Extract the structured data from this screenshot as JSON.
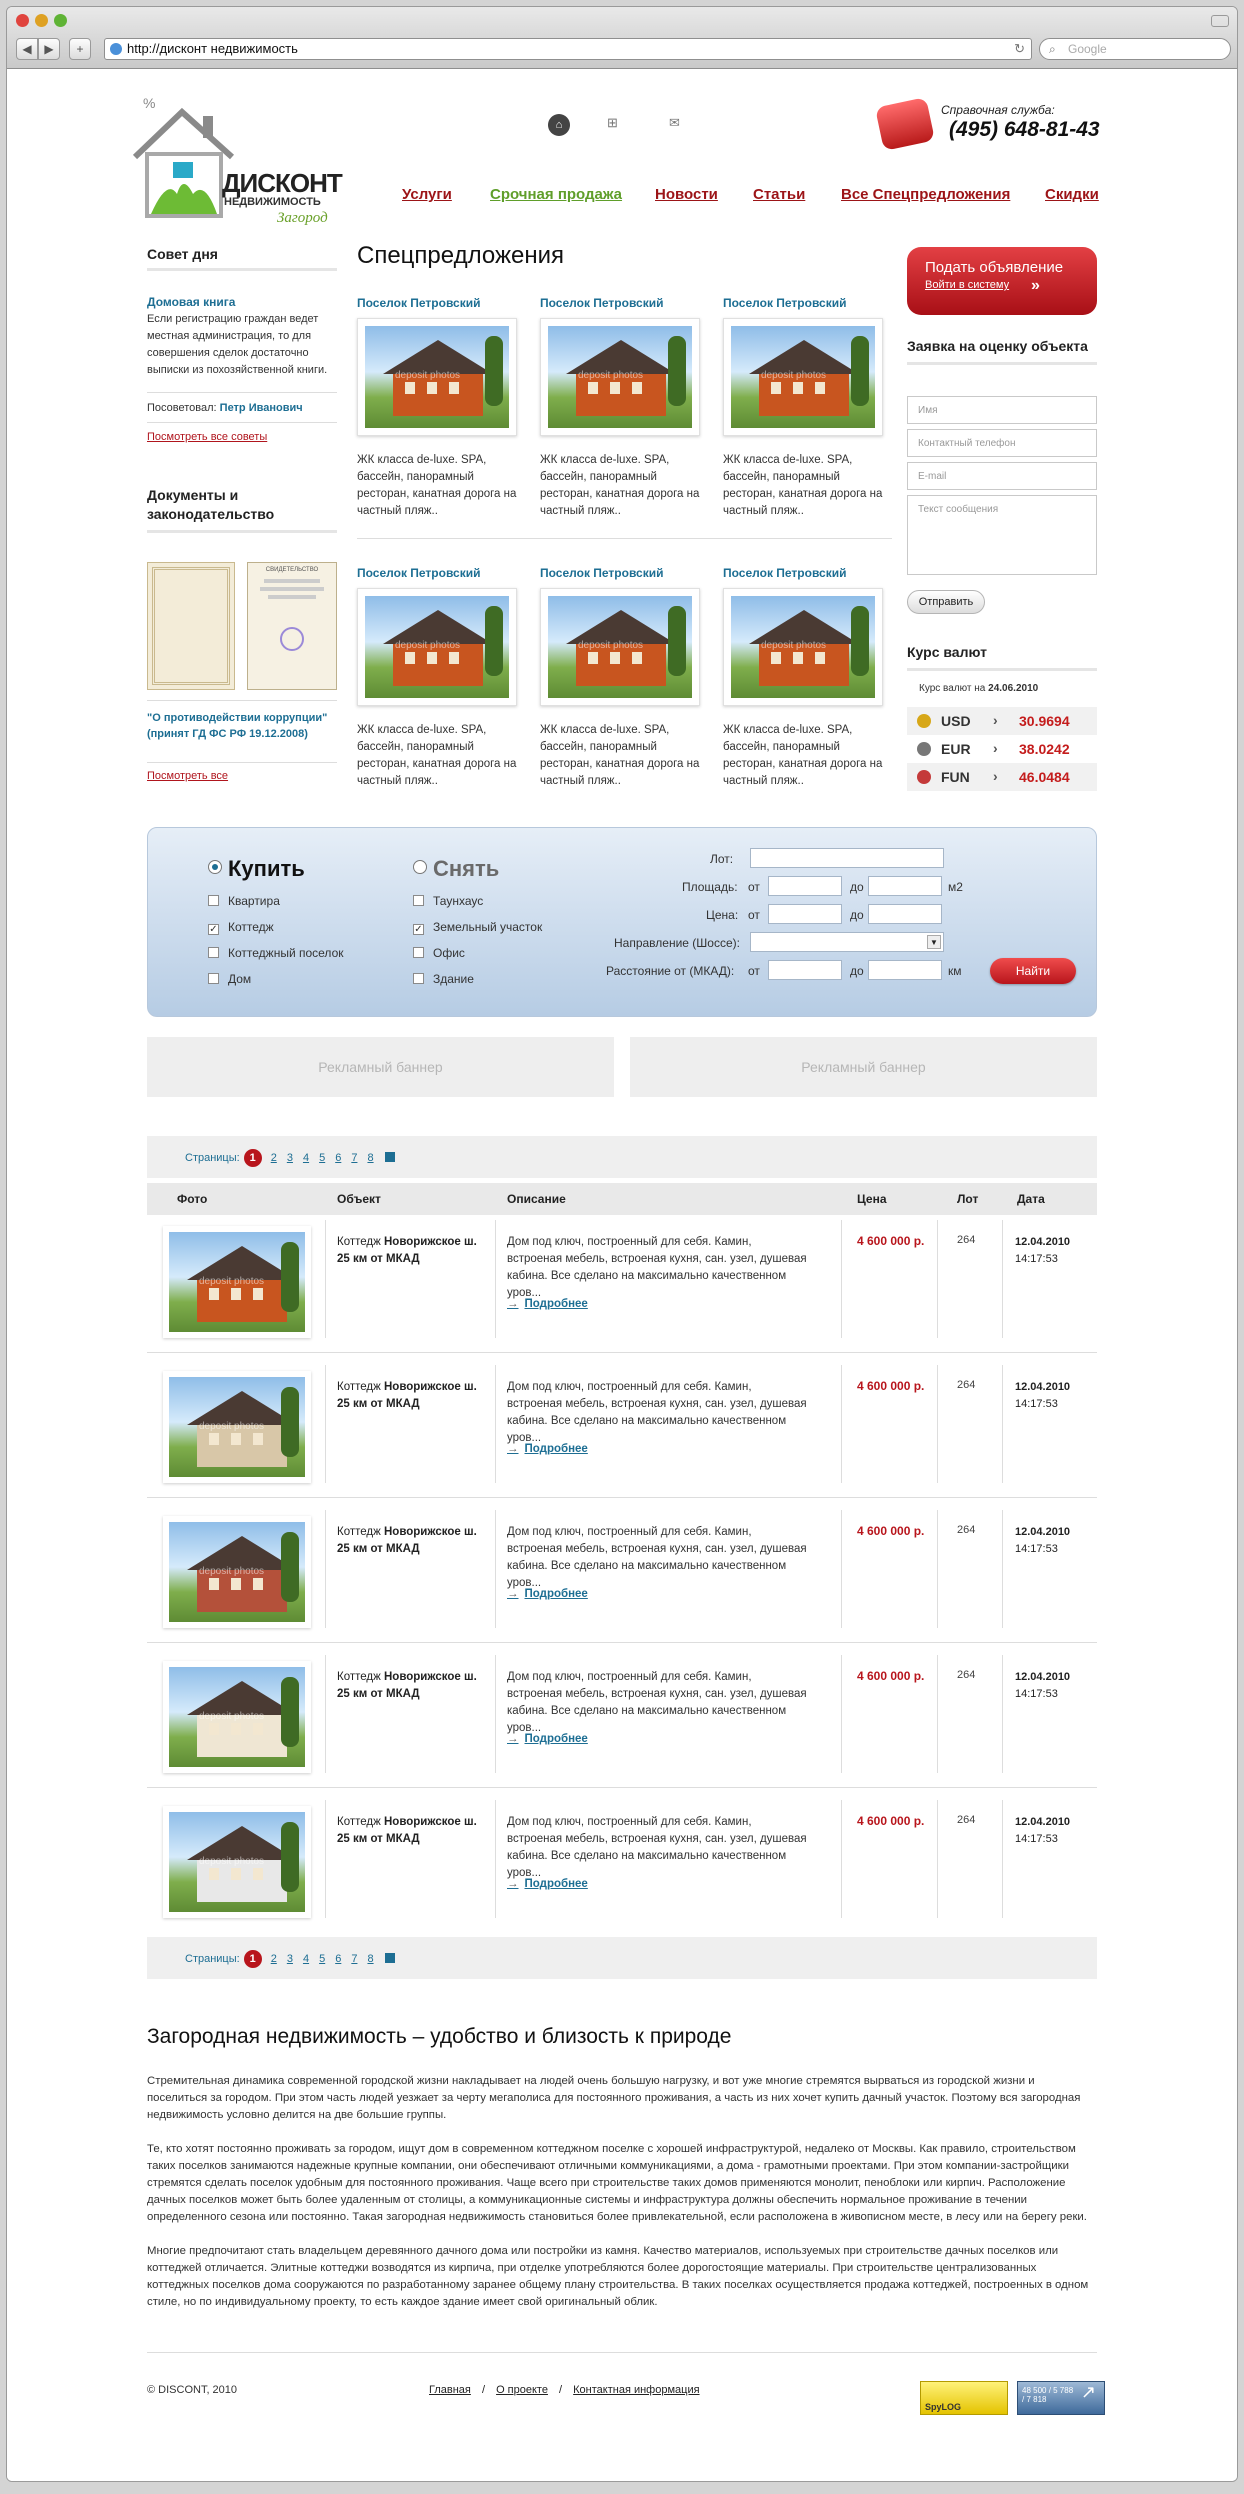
{
  "browser": {
    "url": "http://дисконт недвижимость",
    "search_placeholder": "Google"
  },
  "logo": {
    "line1": "ДИСКОНТ",
    "line2": "НЕДВИЖИМОСТЬ",
    "line3": "Загород"
  },
  "helpline": {
    "label": "Справочная служба:",
    "phone": "(495) 648-81-43"
  },
  "nav": [
    "Услуги",
    "Срочная продажа",
    "Новости",
    "Статьи",
    "Все Спецпредложения",
    "Скидки"
  ],
  "tip": {
    "title": "Совет дня",
    "link": "Домовая книга",
    "text": "Если регистрацию граждан ведет местная администрация, то для совершения сделок достаточно выписки из похозяйственной книги.",
    "author_label": "Посоветовал:",
    "author": "Петр Иванович",
    "all_link": "Посмотреть все советы"
  },
  "docs": {
    "title": "Документы и законодательство",
    "caption": "\"О противодействии коррупции\" (принят ГД ФС РФ 19.12.2008)",
    "all_link": "Посмотреть все",
    "doc_heading": "СВИДЕТЕЛЬСТВО"
  },
  "specials": {
    "title": "Спецпредложения",
    "items": [
      {
        "name": "Поселок Петровский",
        "text": "ЖК класса de-luxe. SPA, бассейн, панорамный ресторан, канатная дорога на частный пляж.."
      },
      {
        "name": "Поселок Петровский",
        "text": "ЖК класса de-luxe. SPA, бассейн, панорамный ресторан, канатная дорога на частный пляж.."
      },
      {
        "name": "Поселок Петровский",
        "text": "ЖК класса de-luxe. SPA, бассейн, панорамный ресторан, канатная дорога на частный пляж.."
      },
      {
        "name": "Поселок Петровский",
        "text": "ЖК класса de-luxe. SPA, бассейн, панорамный ресторан, канатная дорога на частный пляж.."
      },
      {
        "name": "Поселок Петровский",
        "text": "ЖК класса de-luxe. SPA, бассейн, панорамный ресторан, канатная дорога на частный пляж.."
      },
      {
        "name": "Поселок Петровский",
        "text": "ЖК класса de-luxe. SPA, бассейн, панорамный ресторан, канатная дорога на частный пляж.."
      }
    ]
  },
  "ad": {
    "title": "Подать объявление",
    "login": "Войти в систему"
  },
  "form": {
    "title": "Заявка на оценку объекта",
    "name": "Имя",
    "phone": "Контактный телефон",
    "email": "E-mail",
    "message": "Текст сообщения",
    "submit": "Отправить"
  },
  "rates": {
    "title": "Курс валют",
    "date_label": "Курс валют на",
    "date": "24.06.2010",
    "items": [
      {
        "code": "USD",
        "value": "30.9694"
      },
      {
        "code": "EUR",
        "value": "38.0242"
      },
      {
        "code": "FUN",
        "value": "46.0484"
      }
    ]
  },
  "search": {
    "buy": "Купить",
    "rent": "Снять",
    "left": [
      {
        "label": "Квартира",
        "checked": false
      },
      {
        "label": "Коттедж",
        "checked": true
      },
      {
        "label": "Коттеджный поселок",
        "checked": false
      },
      {
        "label": "Дом",
        "checked": false
      }
    ],
    "right": [
      {
        "label": "Таунхаус",
        "checked": false
      },
      {
        "label": "Земельный участок",
        "checked": true
      },
      {
        "label": "Офис",
        "checked": false
      },
      {
        "label": "Здание",
        "checked": false
      }
    ],
    "lot": "Лот:",
    "area": "Площадь:",
    "price": "Цена:",
    "direction": "Направление (Шоссе):",
    "distance": "Расстояние от (МКАД):",
    "from": "от",
    "to": "до",
    "m2": "м2",
    "km": "км",
    "go": "Найти",
    "check": "✓"
  },
  "banners": [
    "Рекламный баннер",
    "Рекламный баннер"
  ],
  "pager": {
    "label": "Страницы:",
    "current": "1",
    "pages": [
      "2",
      "3",
      "4",
      "5",
      "6",
      "7",
      "8"
    ]
  },
  "table": {
    "headers": [
      "Фото",
      "Объект",
      "Описание",
      "Цена",
      "Лот",
      "Дата"
    ],
    "rows": [
      {
        "type": "Коттедж",
        "place": "Новорижское ш. 25 км от МКАД",
        "desc": "Дом под ключ, построенный для себя. Камин, встроеная мебель, встроеная кухня, сан. узел, душевая кабина. Все сделано на максимально качественном уров...",
        "more": "Подробнее",
        "price": "4 600 000 р.",
        "lot": "264",
        "date": "12.04.2010",
        "time": "14:17:53"
      },
      {
        "type": "Коттедж",
        "place": "Новорижское ш. 25 км от МКАД",
        "desc": "Дом под ключ, построенный для себя. Камин, встроеная мебель, встроеная кухня, сан. узел, душевая кабина. Все сделано на максимально качественном уров...",
        "more": "Подробнее",
        "price": "4 600 000 р.",
        "lot": "264",
        "date": "12.04.2010",
        "time": "14:17:53"
      },
      {
        "type": "Коттедж",
        "place": "Новорижское ш. 25 км от МКАД",
        "desc": "Дом под ключ, построенный для себя. Камин, встроеная мебель, встроеная кухня, сан. узел, душевая кабина. Все сделано на максимально качественном уров...",
        "more": "Подробнее",
        "price": "4 600 000 р.",
        "lot": "264",
        "date": "12.04.2010",
        "time": "14:17:53"
      },
      {
        "type": "Коттедж",
        "place": "Новорижское ш. 25 км от МКАД",
        "desc": "Дом под ключ, построенный для себя. Камин, встроеная мебель, встроеная кухня, сан. узел, душевая кабина. Все сделано на максимально качественном уров...",
        "more": "Подробнее",
        "price": "4 600 000 р.",
        "lot": "264",
        "date": "12.04.2010",
        "time": "14:17:53"
      },
      {
        "type": "Коттедж",
        "place": "Новорижское ш. 25 км от МКАД",
        "desc": "Дом под ключ, построенный для себя. Камин, встроеная мебель, встроеная кухня, сан. узел, душевая кабина. Все сделано на максимально качественном уров...",
        "more": "Подробнее",
        "price": "4 600 000 р.",
        "lot": "264",
        "date": "12.04.2010",
        "time": "14:17:53"
      }
    ]
  },
  "article": {
    "title": "Загородная недвижимость – удобство и близость к природе",
    "p1": "Стремительная динамика современной городской жизни накладывает на людей очень большую нагрузку, и вот уже многие стремятся вырваться из городской жизни и поселиться за городом. При этом часть людей уезжает за черту мегаполиса для постоянного проживания, а часть из них хочет купить дачный участок. Поэтому вся загородная недвижимость условно делится на две большие группы.",
    "p2": "Те, кто хотят постоянно проживать за городом, ищут дом в современном коттеджном поселке с хорошей инфраструктурой, недалеко от Москвы. Как правило, строительством таких поселков занимаются надежные крупные компании, они обеспечивают отличными коммуникациями, а дома - грамотными проектами. При этом компании-застройщики стремятся сделать поселок удобным для постоянного проживания. Чаще всего при строительстве таких домов применяются монолит, пеноблоки или кирпич. Расположение дачных поселков может быть более удаленным от столицы, а коммуникационные системы и инфраструктура должны обеспечить нормальное проживание в течении определенного сезона или постоянно. Такая загородная недвижимость становиться более привлекательной, если расположена в живописном месте, в лесу или на берегу реки.",
    "p3": "Многие предпочитают стать владельцем деревянного дачного дома или постройки из камня. Качество материалов, используемых при строительстве дачных поселков или коттеджей отличается. Элитные коттеджи возводятся из кирпича, при отделке употребляются более дорогостоящие материалы. При строительстве централизованных коттеджных поселков дома сооружаются по разработанному заранее общему плану строительства. В таких поселках осуществляется продажа коттеджей, построенных в одном стиле, но по индивидуальному проекту, то есть каждое здание имеет свой оригинальный облик."
  },
  "footer": {
    "copy": "© DISCONT, 2010",
    "links": [
      "Главная",
      "О проекте",
      "Контактная информация"
    ],
    "slash": "/",
    "counter1": "SpyLOG",
    "counter2": "48 500 / 5 788 / 7 818"
  },
  "watermark": "deposit photos"
}
